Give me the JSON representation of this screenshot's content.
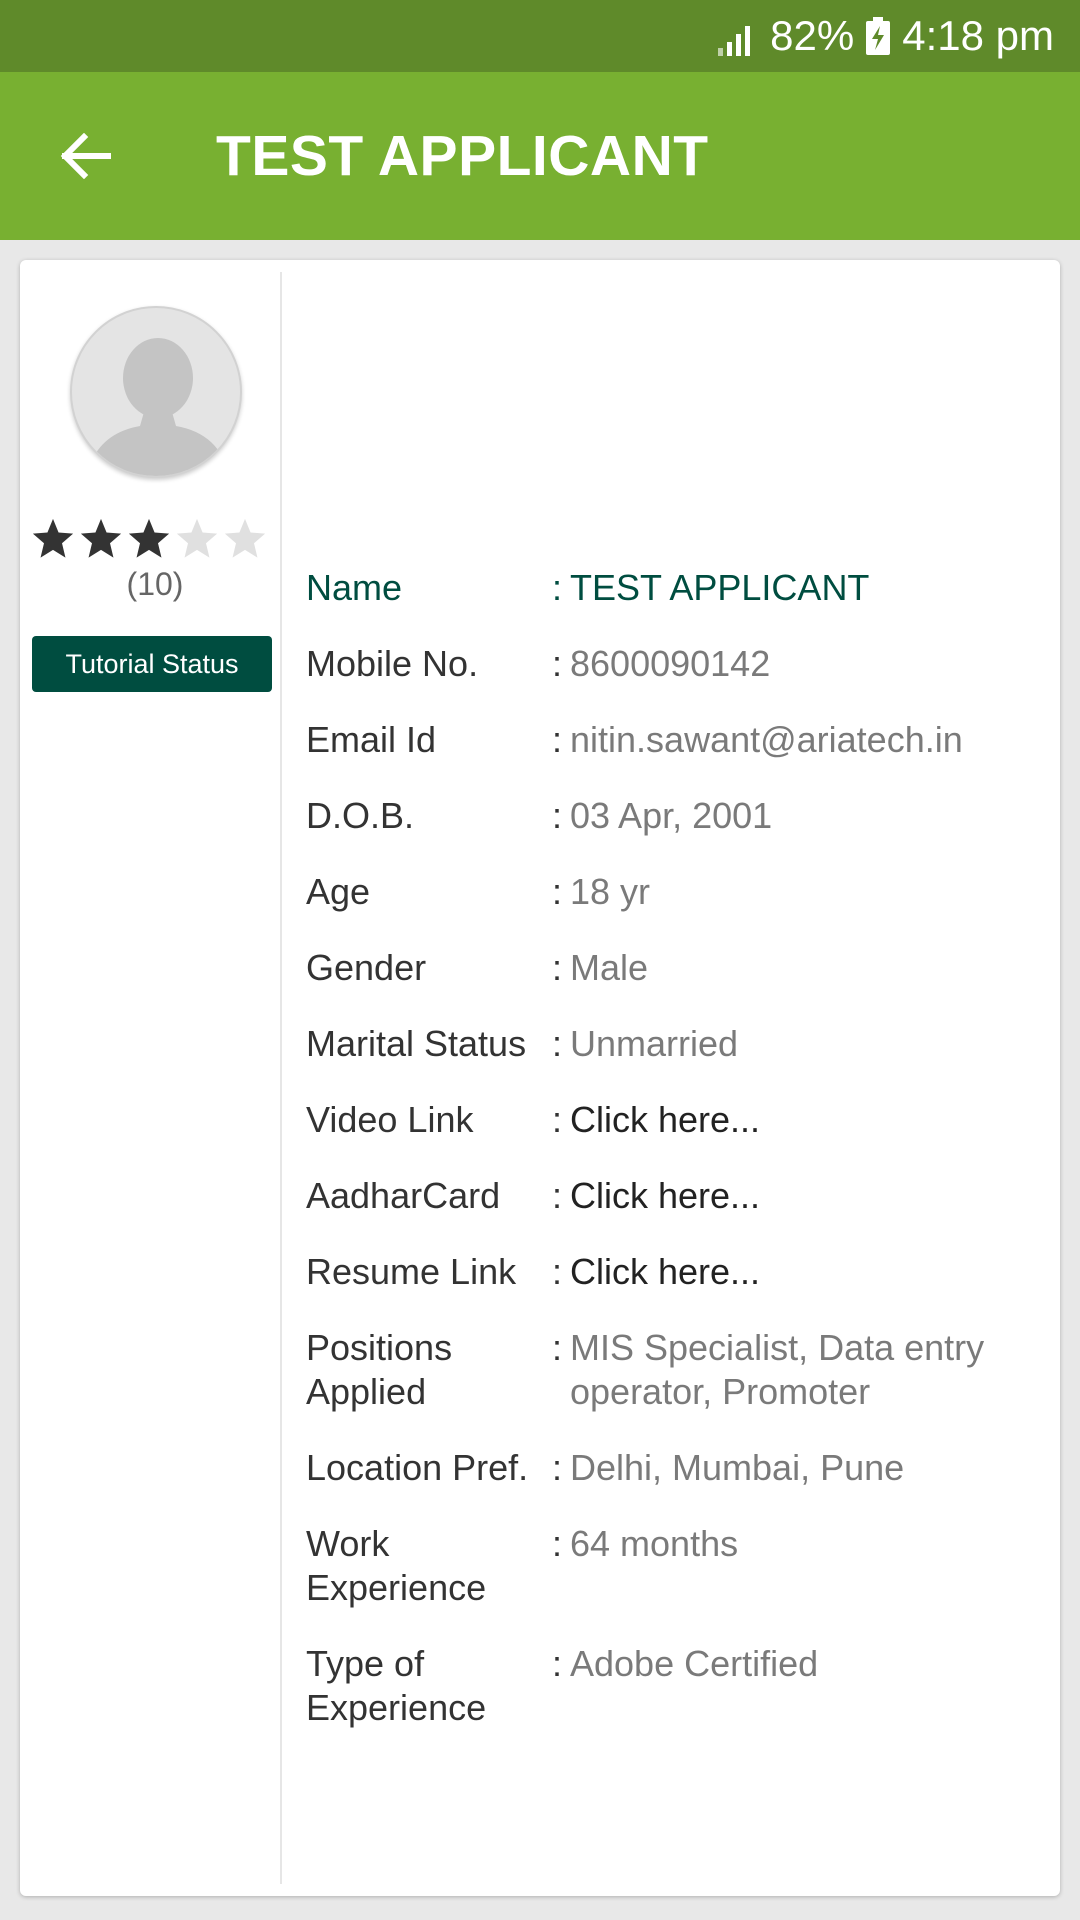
{
  "status_bar": {
    "battery_percent": "82%",
    "time": "4:18 pm"
  },
  "app_bar": {
    "title": "TEST APPLICANT"
  },
  "profile": {
    "rating": {
      "filled": 3,
      "total": 5,
      "count_label": "(10)"
    },
    "tutorial_button": "Tutorial Status"
  },
  "details": [
    {
      "label": "Name",
      "value": "TEST APPLICANT"
    },
    {
      "label": "Mobile No.",
      "value": "8600090142"
    },
    {
      "label": "Email Id",
      "value": "nitin.sawant@ariatech.in"
    },
    {
      "label": "D.O.B.",
      "value": "03 Apr, 2001"
    },
    {
      "label": "Age",
      "value": "18 yr"
    },
    {
      "label": "Gender",
      "value": "Male"
    },
    {
      "label": "Marital Status",
      "value": "Unmarried"
    },
    {
      "label": "Video Link",
      "value": "Click here..."
    },
    {
      "label": "AadharCard",
      "value": "Click here..."
    },
    {
      "label": "Resume Link",
      "value": "Click here..."
    },
    {
      "label": "Positions Applied",
      "value": "MIS Specialist, Data entry operator, Promoter"
    },
    {
      "label": "Location Pref.",
      "value": "Delhi, Mumbai, Pune"
    },
    {
      "label": "Work Experience",
      "value": "64 months"
    },
    {
      "label": "Type of Experience",
      "value": "Adobe Certified"
    }
  ],
  "colors": {
    "status_bar": "#5f8a2a",
    "app_bar": "#78b031",
    "accent_dark_teal": "#004d40",
    "star_filled": "#333333",
    "star_empty": "#e0e0e0"
  },
  "icons": {
    "back": "arrow-left-icon",
    "signal": "signal-icon",
    "battery": "battery-charging-icon",
    "avatar": "person-placeholder-icon",
    "star": "star-icon"
  }
}
